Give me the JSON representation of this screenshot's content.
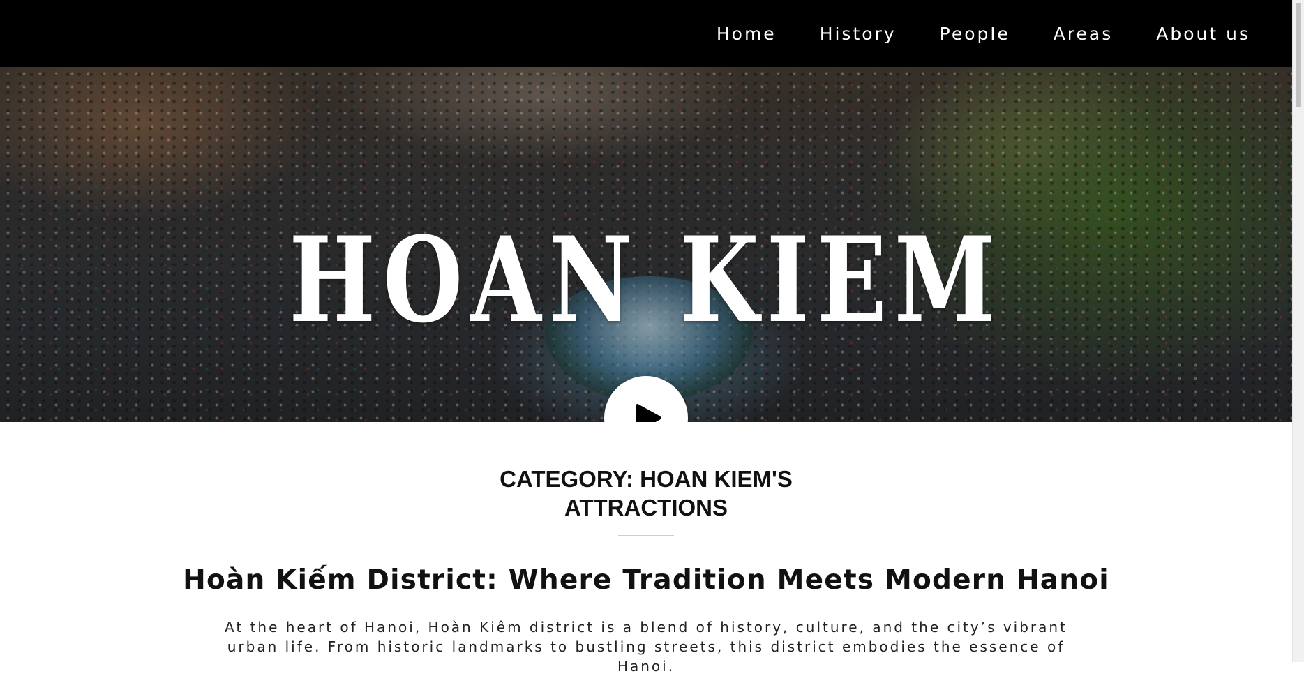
{
  "nav": {
    "items": [
      {
        "label": "Home"
      },
      {
        "label": "History"
      },
      {
        "label": "People"
      },
      {
        "label": "Areas"
      },
      {
        "label": "About us"
      }
    ]
  },
  "hero": {
    "title": "HOAN KIEM",
    "play_icon": "play-icon"
  },
  "category": {
    "line1": "CATEGORY: HOAN KIEM'S",
    "line2": "ATTRACTIONS"
  },
  "post": {
    "title": "Hoàn Kiếm District: Where Tradition Meets Modern Hanoi",
    "excerpt": "At the heart of Hanoi, Hoàn Kiêm district is a blend of history, culture, and the city’s vibrant urban life. From historic landmarks to bustling streets, this district embodies the essence of Hanoi."
  },
  "colors": {
    "topbar": "#000000",
    "text": "#111111",
    "play_bg": "#ffffff"
  }
}
